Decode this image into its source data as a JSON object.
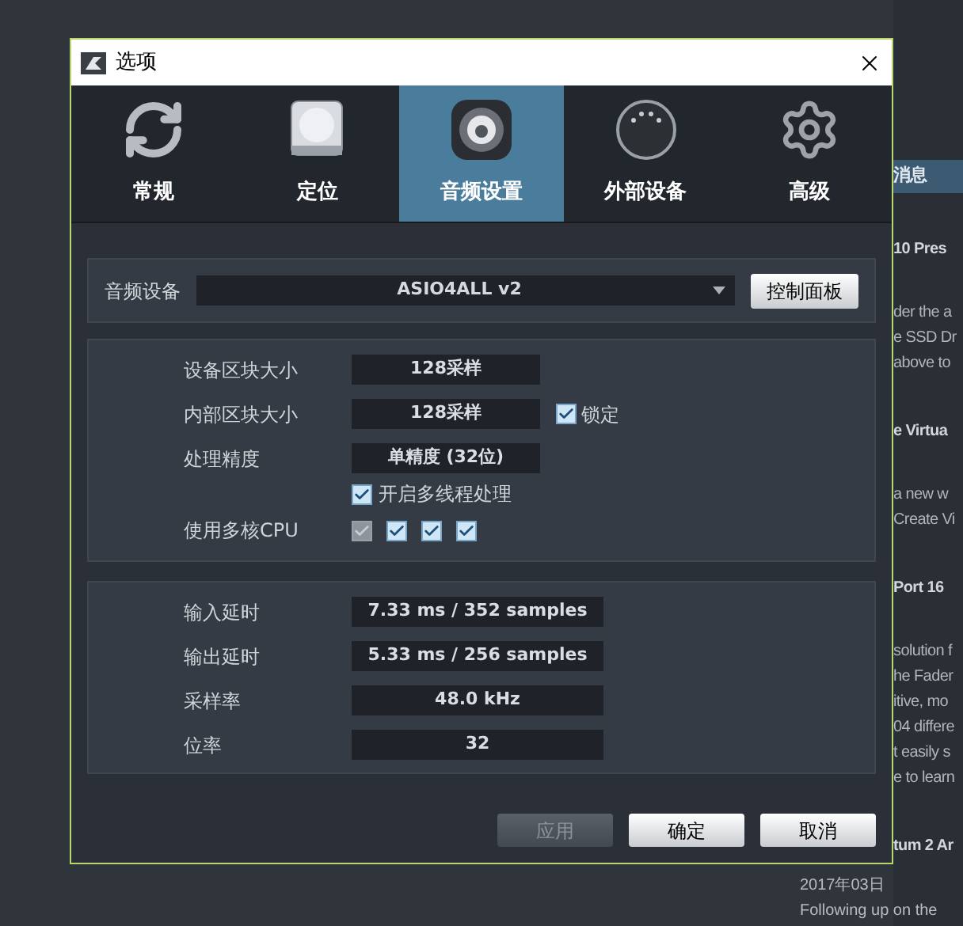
{
  "window": {
    "title": "选项"
  },
  "tabs": [
    {
      "label": "常规",
      "selected": false
    },
    {
      "label": "定位",
      "selected": false
    },
    {
      "label": "音频设置",
      "selected": true
    },
    {
      "label": "外部设备",
      "selected": false
    },
    {
      "label": "高级",
      "selected": false
    }
  ],
  "audio_device": {
    "label": "音频设备",
    "value": "ASIO4ALL v2",
    "button": "控制面板"
  },
  "settings": [
    {
      "kind": "field",
      "label": "设备区块大小",
      "value": "128采样"
    },
    {
      "kind": "field",
      "label": "内部区块大小",
      "value": "128采样",
      "lock": {
        "label": "锁定",
        "checked": true
      }
    },
    {
      "kind": "field",
      "label": "处理精度",
      "value": "单精度 (32位)"
    },
    {
      "kind": "checkbox",
      "label": "开启多线程处理",
      "checked": true
    },
    {
      "kind": "cores",
      "label": "使用多核CPU",
      "cores": [
        {
          "checked": true,
          "disabled": true
        },
        {
          "checked": true,
          "disabled": false
        },
        {
          "checked": true,
          "disabled": false
        },
        {
          "checked": true,
          "disabled": false
        }
      ]
    }
  ],
  "latency": [
    {
      "label": "输入延时",
      "value": "7.33 ms / 352 samples"
    },
    {
      "label": "输出延时",
      "value": "5.33 ms / 256 samples"
    },
    {
      "label": "采样率",
      "value": "48.0 kHz"
    },
    {
      "label": "位率",
      "value": "32"
    }
  ],
  "buttons": [
    {
      "label": "应用",
      "disabled": true
    },
    {
      "label": "确定",
      "disabled": false
    },
    {
      "label": "取消",
      "disabled": false
    }
  ],
  "background": {
    "panel_title": "消息",
    "news": [
      {
        "title": "10 Pres",
        "lines": [
          "der the a",
          "e SSD Dr",
          "above to"
        ]
      },
      {
        "title": "e Virtua",
        "lines": [
          "a new w",
          "Create Vi"
        ]
      },
      {
        "title": "Port 16",
        "lines": [
          "solution f",
          "he Fader",
          "itive, mo",
          "04 differe",
          "t easily s",
          "e to learn"
        ]
      },
      {
        "title": "tum 2 Ar"
      }
    ],
    "date": "2017年03日",
    "teaser": "Following up on the"
  }
}
